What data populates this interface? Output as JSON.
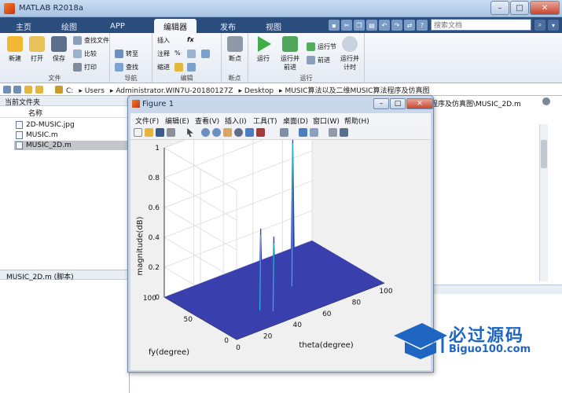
{
  "app": {
    "title": "MATLAB R2018a"
  },
  "tabs": [
    {
      "label": "主页"
    },
    {
      "label": "绘图"
    },
    {
      "label": "APP"
    },
    {
      "label": "编辑器"
    },
    {
      "label": "发布"
    },
    {
      "label": "视图"
    }
  ],
  "search": {
    "placeholder": "搜索文档"
  },
  "ribbon": {
    "file": {
      "new": "新建",
      "open": "打开",
      "save": "保存",
      "find_files": "查找文件",
      "compare": "比较",
      "print": "打印",
      "group": "文件"
    },
    "navigate": {
      "goto": "转至",
      "find": "查找",
      "group": "导航"
    },
    "edit": {
      "insert": "插入",
      "comment": "注释",
      "indent": "缩进",
      "fx": "fx",
      "group": "编辑"
    },
    "breakpoints": {
      "label": "断点",
      "group": "断点"
    },
    "run": {
      "run": "运行",
      "run_advance_1": "运行并",
      "run_advance_2": "前进",
      "run_section": "运行节",
      "advance": "前进",
      "run_time_1": "运行并",
      "run_time_2": "计时",
      "group": "运行"
    }
  },
  "address": {
    "crumbs": [
      "C:",
      "Users",
      "Administrator.WIN7U-20180127Z",
      "Desktop",
      "MUSIC算法以及二维MUSIC算法程序及仿真图"
    ]
  },
  "left_panel": {
    "title": "当前文件夹",
    "column": "名称",
    "files": [
      "2D-MUSIC.jpg",
      "MUSIC.m",
      "MUSIC_2D.m"
    ],
    "details": "MUSIC_2D.m  (脚本)"
  },
  "editor": {
    "path": "程序及仿真图\\MUSIC_2D.m"
  },
  "figure": {
    "title": "Figure 1",
    "menu": [
      "文件(F)",
      "编辑(E)",
      "查看(V)",
      "插入(I)",
      "工具(T)",
      "桌面(D)",
      "窗口(W)",
      "帮助(H)"
    ]
  },
  "chart_data": {
    "type": "surface3d",
    "zlabel": "magnitude(dB)",
    "ylabel": "fy(degree)",
    "xlabel": "theta(degree)",
    "zticks": [
      "0",
      "0.2",
      "0.4",
      "0.6",
      "0.8",
      "1"
    ],
    "yticks": [
      "0",
      "50",
      "100"
    ],
    "xticks": [
      "0",
      "20",
      "40",
      "60",
      "80",
      "100"
    ],
    "zlim": [
      0,
      1
    ],
    "xlim": [
      0,
      100
    ],
    "ylim": [
      0,
      100
    ],
    "peaks": [
      {
        "theta": 60,
        "fy": 45,
        "magnitude": 1.0
      },
      {
        "theta": 30,
        "fy": 28,
        "magnitude": 0.55
      },
      {
        "theta": 35,
        "fy": 20,
        "magnitude": 0.5
      }
    ],
    "surface_color": "#3a3fae"
  },
  "watermark": {
    "text": "必过源码",
    "url": "Biguo100.com"
  },
  "colors": {
    "ribbon_tab_bar": "#2a4d7d",
    "surface": "#3a3fae",
    "peak": "#2ab7d6"
  }
}
